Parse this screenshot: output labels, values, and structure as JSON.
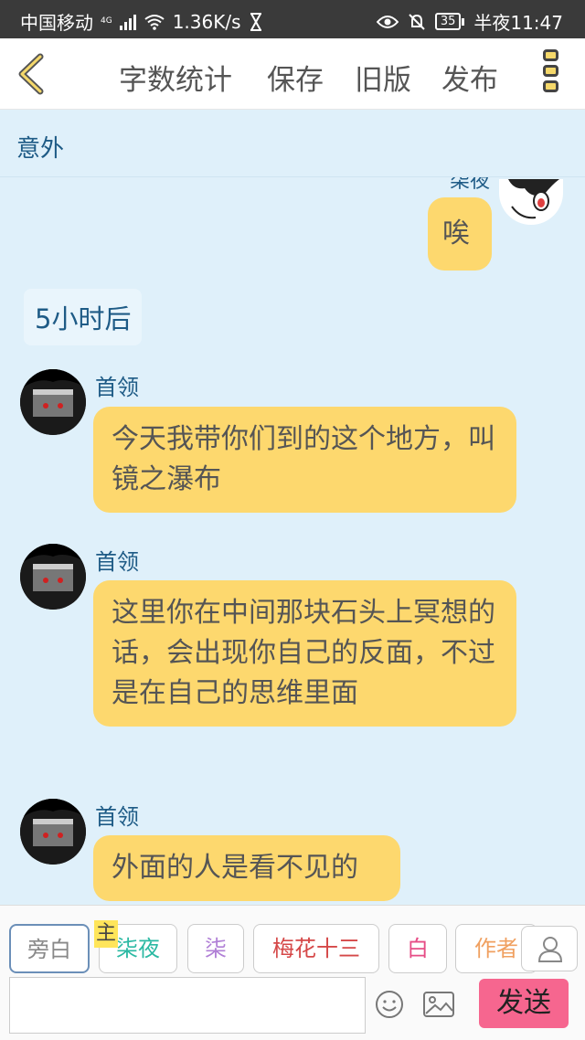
{
  "status_bar": {
    "carrier": "中国移动",
    "network_type": "4G",
    "speed": "1.36K/s",
    "battery": "35",
    "time": "半夜11:47"
  },
  "toolbar": {
    "word_count_label": "字数统计",
    "save_label": "保存",
    "old_version_label": "旧版",
    "publish_label": "发布"
  },
  "chat": {
    "title": "意外",
    "right_sender": "柒夜",
    "right_message": "唉",
    "time_divider": "5小时后",
    "messages": [
      {
        "sender": "首领",
        "text": "今天我带你们到的这个地方，叫镜之瀑布"
      },
      {
        "sender": "首领",
        "text": "这里你在中间那块石头上冥想的话，会出现你自己的反面，不过是在自己的思维里面"
      },
      {
        "sender": "首领",
        "text": "外面的人是看不见的"
      }
    ]
  },
  "roles": {
    "main_tag": "主",
    "items": [
      {
        "label": "旁白",
        "color": "#888888"
      },
      {
        "label": "柒夜",
        "color": "#2bb9a3"
      },
      {
        "label": "柒",
        "color": "#b07fd6"
      },
      {
        "label": "梅花十三",
        "color": "#d54848"
      },
      {
        "label": "白",
        "color": "#e64d86"
      },
      {
        "label": "作者",
        "color": "#f0a060"
      }
    ]
  },
  "composer": {
    "input_value": "",
    "send_label": "发送"
  },
  "colors": {
    "bubble": "#fdd86e",
    "background": "#dff0fa",
    "send_button": "#f6668f",
    "accent_text": "#1e5b86"
  }
}
